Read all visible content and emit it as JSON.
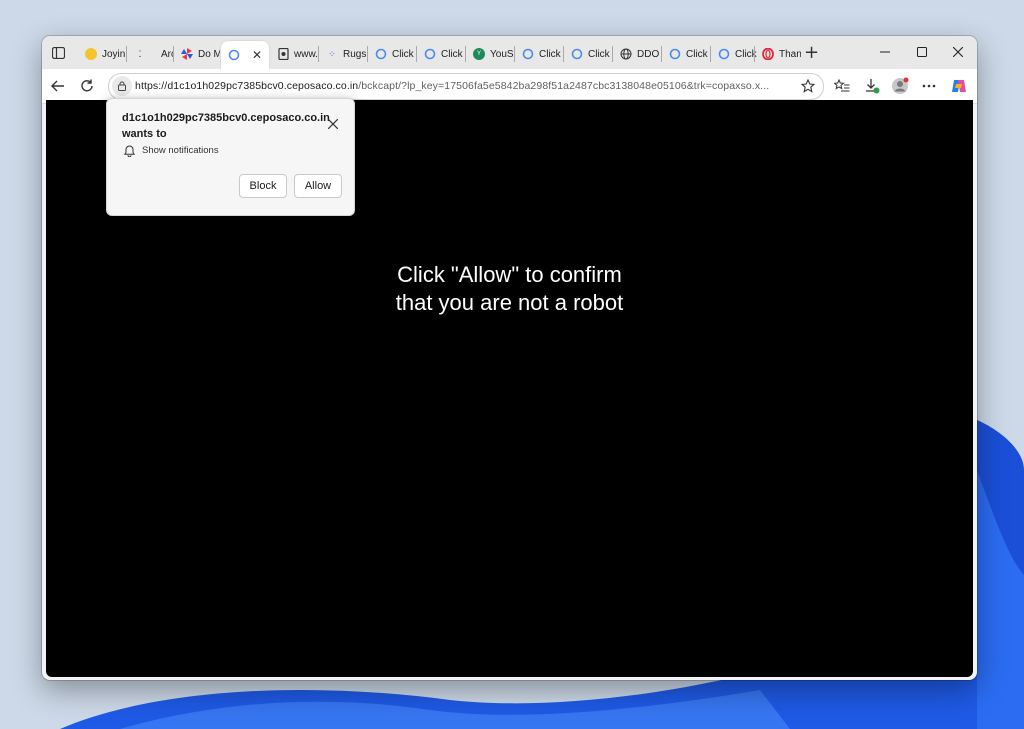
{
  "colors": {
    "wallpaper_bg": "#c9d8ea",
    "wallpaper_bloom": "#1a4fd6",
    "page_bg": "#000000",
    "page_text": "#ffffff",
    "tabbar_bg": "#e8e8e8"
  },
  "browser": {
    "tab_actions_icon": "vertical-tabs-icon",
    "tabs": [
      {
        "title": "Joyin",
        "icon": "yellow-circle-icon"
      },
      {
        "title": "Aron",
        "icon": "dots-icon"
      },
      {
        "title": "Do M",
        "icon": "pinwheel-icon"
      },
      {
        "title": "",
        "icon": "blue-shapes-icon",
        "active": true
      },
      {
        "title": "www.",
        "icon": "page-icon"
      },
      {
        "title": "Rugs",
        "icon": "dots-icon"
      },
      {
        "title": "Click",
        "icon": "blue-shapes-icon"
      },
      {
        "title": "Click",
        "icon": "blue-shapes-icon"
      },
      {
        "title": "YouS",
        "icon": "green-circle-icon"
      },
      {
        "title": "Click",
        "icon": "blue-shapes-icon"
      },
      {
        "title": "Click",
        "icon": "blue-shapes-icon"
      },
      {
        "title": "DDO",
        "icon": "globe-icon"
      },
      {
        "title": "Click",
        "icon": "blue-shapes-icon"
      },
      {
        "title": "Click",
        "icon": "blue-shapes-icon"
      },
      {
        "title": "Than",
        "icon": "opera-icon"
      }
    ],
    "new_tab": "+",
    "url_host": "https://d1c1o1h029pc7385bcv0.ceposaco.co.in",
    "url_rest": "/bckcapt/?lp_key=17506fa5e5842ba298f51a2487cbc3138048e05106&trk=copaxso.x..."
  },
  "popup": {
    "origin": "d1c1o1h029pc7385bcv0.ceposaco.co.in",
    "wants": "wants to",
    "permission": "Show notifications",
    "block_label": "Block",
    "allow_label": "Allow"
  },
  "page": {
    "line1": "Click \"Allow\" to confirm",
    "line2": "that you are not a robot"
  }
}
